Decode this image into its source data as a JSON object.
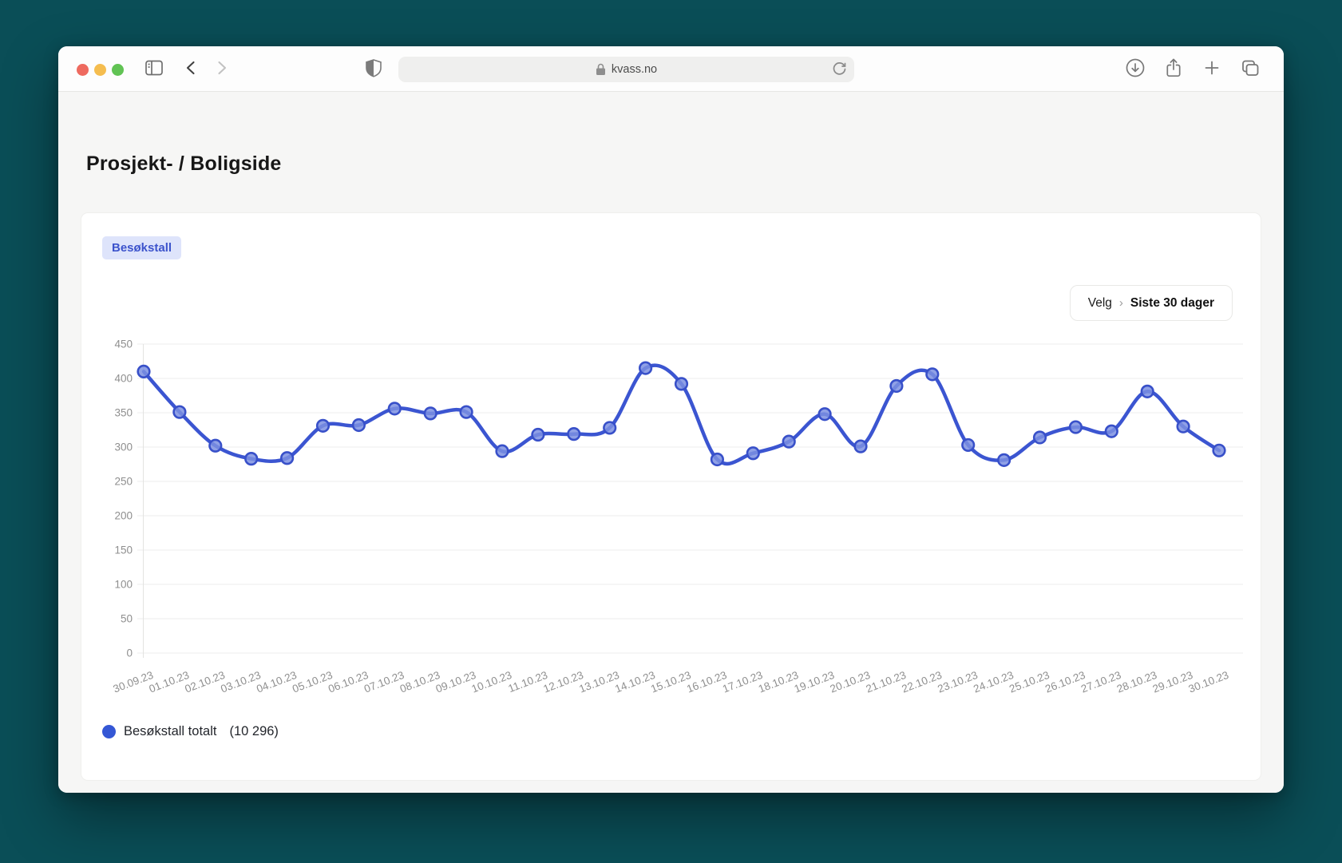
{
  "browser": {
    "url": "kvass.no",
    "window_controls": [
      "close",
      "minimize",
      "zoom"
    ],
    "icons": [
      "sidebar-icon",
      "back-icon",
      "forward-icon",
      "shield-icon",
      "lock-icon",
      "reload-icon",
      "download-icon",
      "share-icon",
      "new-tab-icon",
      "tab-overview-icon"
    ]
  },
  "page": {
    "title": "Prosjekt- / Boligside"
  },
  "card": {
    "badge": "Besøkstall",
    "range_selector": {
      "prefix": "Velg",
      "chevron": "›",
      "value": "Siste 30 dager"
    },
    "legend": {
      "label": "Besøkstall totalt",
      "total_display": "(10 296)"
    }
  },
  "chart_data": {
    "type": "line",
    "title": "",
    "xlabel": "",
    "ylabel": "",
    "x": [
      "30.09.23",
      "01.10.23",
      "02.10.23",
      "03.10.23",
      "04.10.23",
      "05.10.23",
      "06.10.23",
      "07.10.23",
      "08.10.23",
      "09.10.23",
      "10.10.23",
      "11.10.23",
      "12.10.23",
      "13.10.23",
      "14.10.23",
      "15.10.23",
      "16.10.23",
      "17.10.23",
      "18.10.23",
      "19.10.23",
      "20.10.23",
      "21.10.23",
      "22.10.23",
      "23.10.23",
      "24.10.23",
      "25.10.23",
      "26.10.23",
      "27.10.23",
      "28.10.23",
      "29.10.23",
      "30.10.23"
    ],
    "series": [
      {
        "name": "Besøkstall totalt",
        "total": 10296,
        "values": [
          410,
          351,
          302,
          283,
          284,
          331,
          332,
          356,
          349,
          351,
          294,
          318,
          319,
          328,
          415,
          392,
          282,
          291,
          308,
          348,
          301,
          389,
          406,
          303,
          281,
          314,
          329,
          323,
          381,
          330,
          295
        ]
      }
    ],
    "ylim": [
      0,
      450
    ],
    "ytick_step": 50,
    "grid": true,
    "legend_position": "bottom-left",
    "line_color": "#3b55d1",
    "point_fill": "#7d90e2",
    "point_stroke": "#3850c9",
    "grid_color": "#ededec",
    "axis_color": "#e3e3e1",
    "legend_dot_color": "#3457d5"
  },
  "colors": {
    "desktop_background": "#0a4e57",
    "page_background": "#f6f6f5",
    "badge_background": "#dee4fb",
    "badge_text": "#3c53cc"
  }
}
